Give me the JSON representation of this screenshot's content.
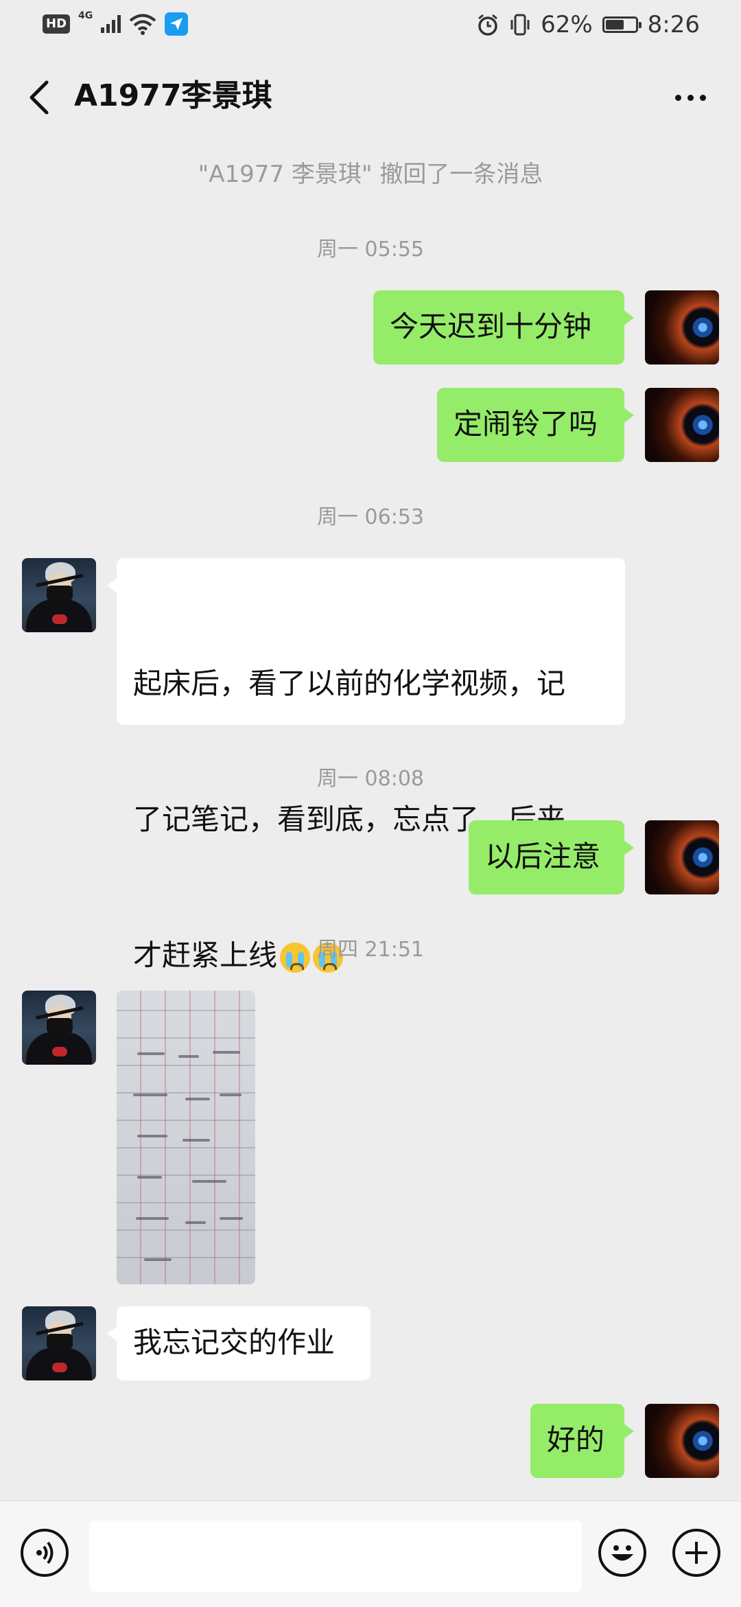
{
  "status_bar": {
    "hd": "HD",
    "network": "4G",
    "battery_percent": "62%",
    "battery_level": 0.62,
    "time": "8:26",
    "icons": [
      "hd-icon",
      "signal-icon",
      "wifi-icon",
      "app-notification-icon",
      "alarm-icon",
      "vibrate-icon",
      "battery-icon",
      "leaf-icon"
    ]
  },
  "nav": {
    "title": "A1977李景琪",
    "back_icon": "back-chevron-icon",
    "more_icon": "more-icon"
  },
  "messages": {
    "recall_notice": "\"A1977 李景琪\" 撤回了一条消息",
    "ts1": "周一 05:55",
    "m1": "今天迟到十分钟",
    "m2": "定闹铃了吗",
    "ts2": "周一 06:53",
    "m3_line1": "起床后，看了以前的化学视频，记",
    "m3_line2": "了记笔记，看到底，忘点了，后来",
    "m3_line3": "才赶紧上线",
    "ts3": "周一 08:08",
    "m4": "以后注意",
    "ts4": "周四 21:51",
    "m6": "我忘记交的作业",
    "m7": "好的"
  },
  "input_bar": {
    "voice_icon": "voice-icon",
    "emoji_icon": "emoji-icon",
    "plus_icon": "plus-icon",
    "value": ""
  }
}
